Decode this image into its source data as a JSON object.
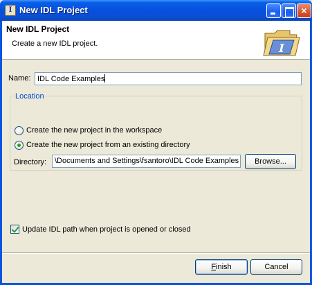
{
  "window": {
    "title": "New IDL Project",
    "icon": "idl-icon",
    "controls": {
      "minimize": "minimize-icon",
      "maximize": "maximize-icon",
      "close": "×"
    }
  },
  "banner": {
    "title": "New IDL Project",
    "subtitle": "Create a new IDL project.",
    "icon": "folder-idl-icon"
  },
  "form": {
    "name_label": "Name:",
    "name_value": "IDL Code Examples",
    "location": {
      "legend": "Location",
      "options": [
        {
          "label": "Create the new project in the workspace",
          "selected": false
        },
        {
          "label": "Create the new project from an existing directory",
          "selected": true
        }
      ],
      "directory_label": "Directory:",
      "directory_value": "\\Documents and Settings\\fsantoro\\IDL Code Examples",
      "browse_label": "Browse..."
    },
    "update_path": {
      "label": "Update IDL path when project is opened or closed",
      "checked": true
    }
  },
  "buttons": {
    "finish_mnemonic": "F",
    "finish_rest": "inish",
    "cancel_label": "Cancel"
  },
  "colors": {
    "titlebar": "#0a54e0",
    "dialog_bg": "#ece9d8",
    "group_legend": "#0046d5",
    "radio_dot": "#21a121"
  }
}
